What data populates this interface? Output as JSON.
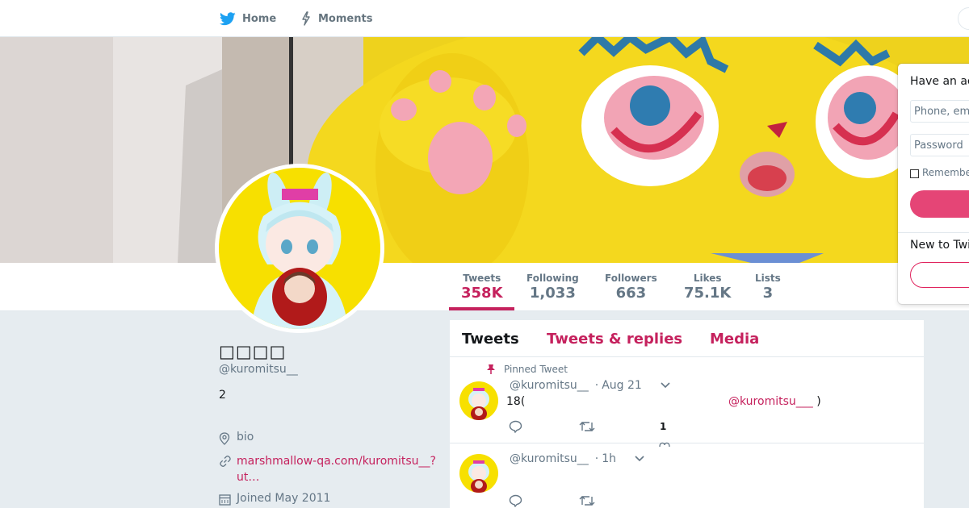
{
  "nav": {
    "home_label": "Home",
    "moments_label": "Moments"
  },
  "profile": {
    "display_name": "□□□□",
    "handle": "@kuromitsu__",
    "bio": "2",
    "location": "bio",
    "website": "marshmallow-qa.com/kuromitsu__?ut…",
    "joined": "Joined May 2011"
  },
  "stats": [
    {
      "label": "Tweets",
      "value": "358K",
      "active": true
    },
    {
      "label": "Following",
      "value": "1,033"
    },
    {
      "label": "Followers",
      "value": "663"
    },
    {
      "label": "Likes",
      "value": "75.1K"
    },
    {
      "label": "Lists",
      "value": "3"
    }
  ],
  "timeline": {
    "tabs": [
      {
        "label": "Tweets",
        "active": true
      },
      {
        "label": "Tweets & replies"
      },
      {
        "label": "Media"
      }
    ],
    "tweets": [
      {
        "pinned_label": "Pinned Tweet",
        "handle": "@kuromitsu__",
        "time": "Aug 21",
        "text": "18(",
        "mention": "@kuromitsu___",
        "mention_close": " )",
        "like_count": "1"
      },
      {
        "handle": "@kuromitsu__",
        "time": "1h"
      }
    ]
  },
  "login": {
    "have_account": "Have an account?",
    "phone_placeholder": "Phone, email, or username",
    "password_placeholder": "Password",
    "remember_label": "Remember me",
    "new_to_twitter": "New to Twitter?"
  },
  "colors": {
    "accent": "#c5215d",
    "login_button": "#e0245e",
    "page_bg": "#e6ecf0"
  },
  "icons": {
    "home": "twitter-bird-icon",
    "moments": "lightning-icon",
    "location": "location-pin-icon",
    "link": "link-icon",
    "calendar": "calendar-icon",
    "pin": "pin-icon",
    "reply": "reply-icon",
    "retweet": "retweet-icon",
    "like": "heart-icon",
    "chevron": "chevron-down-icon"
  }
}
